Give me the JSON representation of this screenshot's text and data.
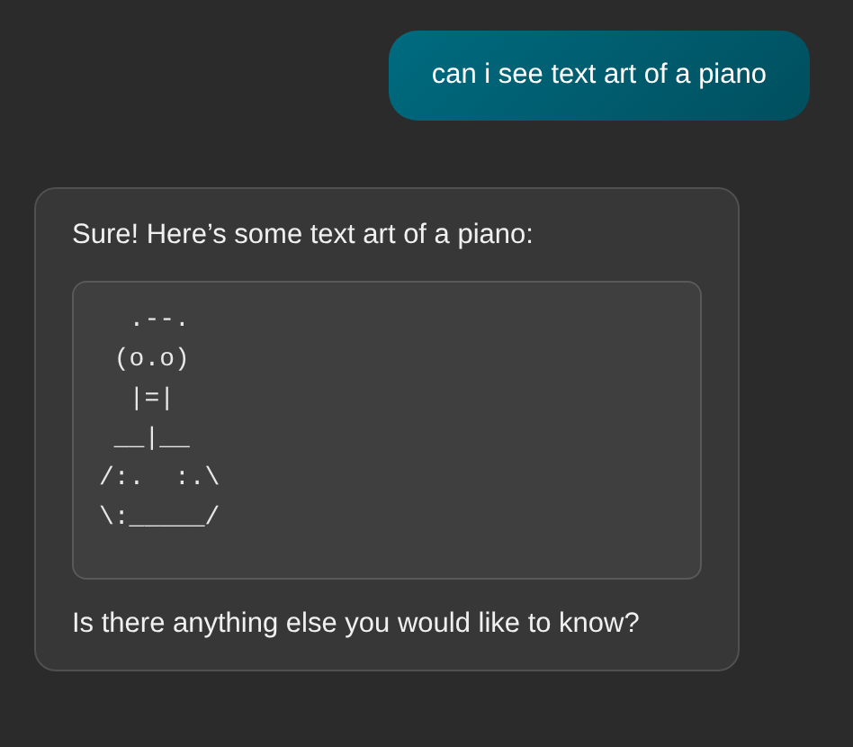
{
  "messages": [
    {
      "kind": "user",
      "text": "can i see text art of a piano"
    },
    {
      "kind": "assistant",
      "intro": "Sure! Here’s some text art of a piano:",
      "code_lines": [
        "  .--.",
        " (o.o)",
        "  |=|",
        " __|__",
        "/:.  :.\\",
        "\\:_____/"
      ],
      "outro": "Is there anything else you would like to know?"
    }
  ]
}
